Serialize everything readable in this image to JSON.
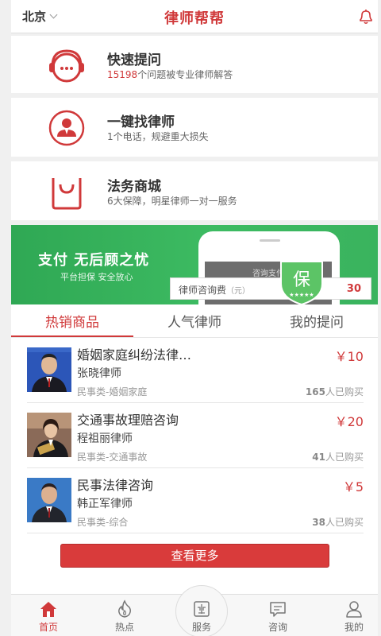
{
  "header": {
    "city": "北京",
    "title": "律师帮帮"
  },
  "features": [
    {
      "title": "快速提问",
      "sub_num": "15198",
      "sub_text": "个问题被专业律师解答",
      "icon": "headset-icon"
    },
    {
      "title": "一键找律师",
      "sub_text": "1个电话，规避重大损失",
      "icon": "lawyer-icon"
    },
    {
      "title": "法务商城",
      "sub_text": "6大保障，明星律师一对一服务",
      "icon": "shopping-bag-icon"
    }
  ],
  "banner": {
    "title": "支付 无后顾之忧",
    "subtitle": "平台担保   安全放心",
    "screen_label": "咨询支付",
    "fee_label": "律师咨询费",
    "fee_unit": "（元）",
    "fee_amount": "30",
    "shield_text": "保",
    "colors": {
      "green": "#3dbb62"
    }
  },
  "tabs": [
    {
      "label": "热销商品",
      "active": true
    },
    {
      "label": "人气律师",
      "active": false
    },
    {
      "label": "我的提问",
      "active": false
    }
  ],
  "products": [
    {
      "name": "婚姻家庭纠纷法律…",
      "price": "￥10",
      "lawyer": "张晓律师",
      "category": "民事类-婚姻家庭",
      "bought_num": "165",
      "bought_text": "人已购买"
    },
    {
      "name": "交通事故理赔咨询",
      "price": "￥20",
      "lawyer": "程祖丽律师",
      "category": "民事类-交通事故",
      "bought_num": "41",
      "bought_text": "人已购买"
    },
    {
      "name": "民事法律咨询",
      "price": "￥5",
      "lawyer": "韩正军律师",
      "category": "民事类-综合",
      "bought_num": "38",
      "bought_text": "人已购买"
    }
  ],
  "more_button": "查看更多",
  "bottom_nav": [
    {
      "label": "首页",
      "icon": "home-icon",
      "active": true
    },
    {
      "label": "热点",
      "icon": "flame-icon",
      "active": false
    },
    {
      "label": "服务",
      "icon": "service-icon",
      "active": false
    },
    {
      "label": "咨询",
      "icon": "chat-icon",
      "active": false
    },
    {
      "label": "我的",
      "icon": "user-icon",
      "active": false
    }
  ],
  "accent_color": "#d0393a"
}
